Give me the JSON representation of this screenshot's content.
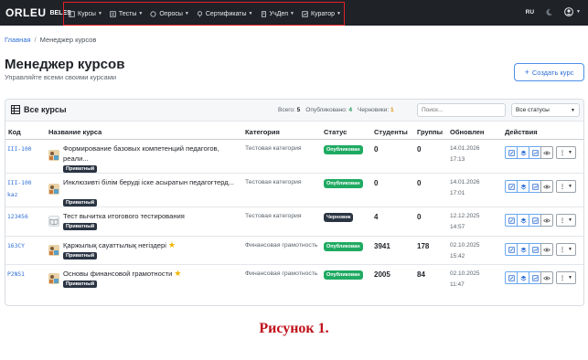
{
  "navbar": {
    "logo": "ORLEU",
    "logo_sub": "BELES",
    "menu": [
      {
        "label": "Курсы",
        "icon": "book-icon"
      },
      {
        "label": "Тесты",
        "icon": "list-icon"
      },
      {
        "label": "Опросы",
        "icon": "poll-icon"
      },
      {
        "label": "Сертификаты",
        "icon": "award-icon"
      },
      {
        "label": "УчДеп",
        "icon": "building-icon"
      },
      {
        "label": "Куратор",
        "icon": "chart-icon"
      }
    ],
    "lang": "RU",
    "theme_icon": "moon-icon",
    "user_icon": "user-circle-icon",
    "highlight_color": "#e0202a"
  },
  "breadcrumb": {
    "home": "Главная",
    "separator": "/",
    "current": "Менеджер курсов"
  },
  "page": {
    "title": "Менеджер курсов",
    "subtitle": "Управляйте всеми своими курсами",
    "create_button": "Создать курс"
  },
  "card": {
    "title": "Все курсы",
    "stats": {
      "total_label": "Всего:",
      "total": "5",
      "published_label": "Опубликовано:",
      "published": "4",
      "drafts_label": "Черновики:",
      "drafts": "1"
    },
    "search_placeholder": "Поиск...",
    "status_filter": "Все статусы"
  },
  "table": {
    "columns": [
      "Код",
      "Название курса",
      "Категория",
      "Статус",
      "Студенты",
      "Группы",
      "Обновлен",
      "Действия"
    ],
    "rows": [
      {
        "code": "III-100",
        "name": "Формирование базовых компетенций педагогов, реали...",
        "private": "Приватный",
        "category": "Тестовая категория",
        "status": "Опубликован",
        "students": "0",
        "groups": "0",
        "date": "14.01.2026",
        "time": "17:13",
        "star": false
      },
      {
        "code": "III-100kaz",
        "name": "Инклюзивті білім беруді іске асыратын педагогтерд...",
        "private": "Приватный",
        "category": "Тестовая категория",
        "status": "Опубликован",
        "students": "0",
        "groups": "0",
        "date": "14.01.2026",
        "time": "17:01",
        "star": false
      },
      {
        "code": "123456",
        "name": "Тест вычитка итогового тестирования",
        "private": "Приватный",
        "category": "Тестовая категория",
        "status": "Черновик",
        "students": "4",
        "groups": "0",
        "date": "12.12.2025",
        "time": "14:57",
        "star": false
      },
      {
        "code": "163CY",
        "name": "Қаржылық сауаттылық негіздері",
        "private": "Приватный",
        "category": "Финансовая грамотность",
        "status": "Опубликован",
        "students": "3941",
        "groups": "178",
        "date": "02.10.2025",
        "time": "15:42",
        "star": true
      },
      {
        "code": "P2NS1",
        "name": "Основы финансовой грамотности",
        "private": "Приватный",
        "category": "Финансовая грамотность",
        "status": "Опубликован",
        "students": "2005",
        "groups": "84",
        "date": "02.10.2025",
        "time": "11:47",
        "star": true
      }
    ],
    "status_colors": {
      "Опубликован": "#1faa62",
      "Черновик": "#2a3442"
    }
  },
  "caption": "Рисунок 1."
}
